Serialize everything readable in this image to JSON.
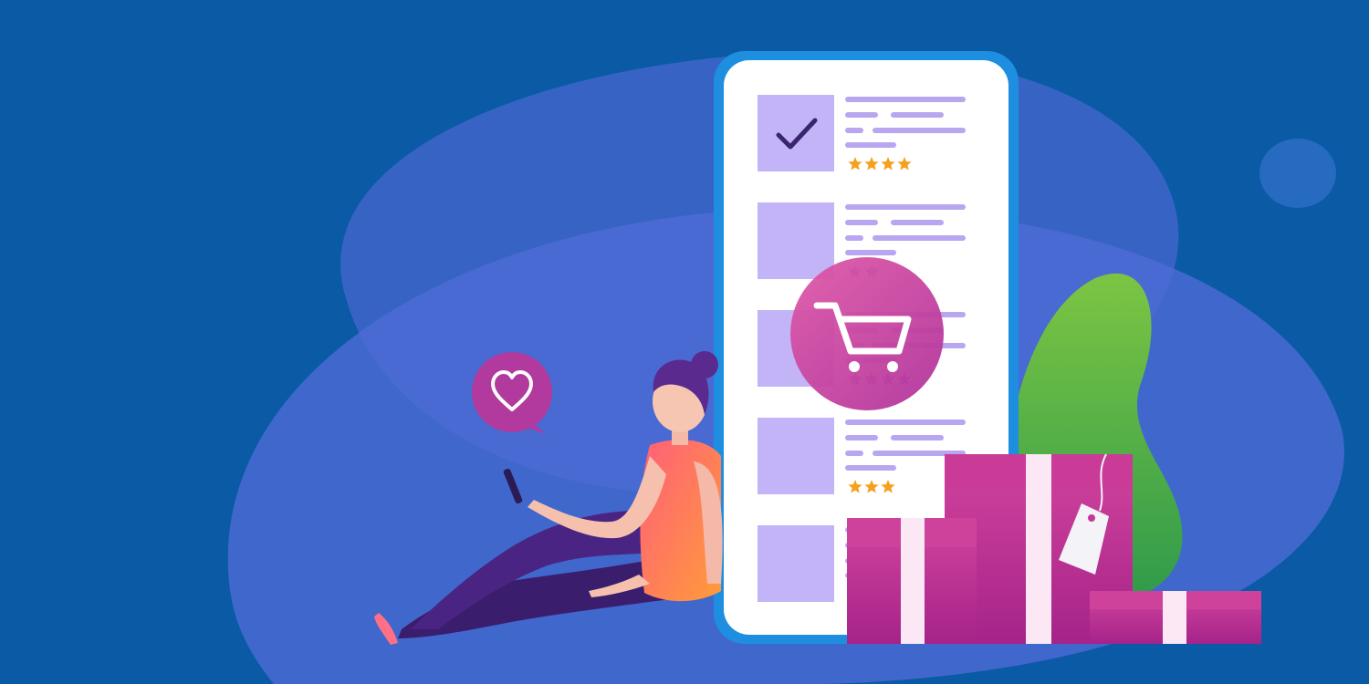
{
  "colors": {
    "background": "#0a5aa6",
    "blob_light": "#5b78d8",
    "blob_mid": "#4a63c9",
    "phone_frame": "#1d8fe0",
    "phone_screen": "#ffffff",
    "thumb": "#c2b4f7",
    "line": "#b9a6f0",
    "star": "#f4a11d",
    "accent_magenta": "#c2338f",
    "leaf": "#5eb64a"
  },
  "products": [
    {
      "checked": true,
      "stars": 4
    },
    {
      "checked": false,
      "stars": 2
    },
    {
      "checked": false,
      "stars": 4
    },
    {
      "checked": false,
      "stars": 3
    },
    {
      "checked": false,
      "stars": 0
    }
  ],
  "icons": {
    "cart": "shopping-cart-icon",
    "heart": "heart-icon",
    "check": "check-icon",
    "tag": "price-tag-icon"
  }
}
